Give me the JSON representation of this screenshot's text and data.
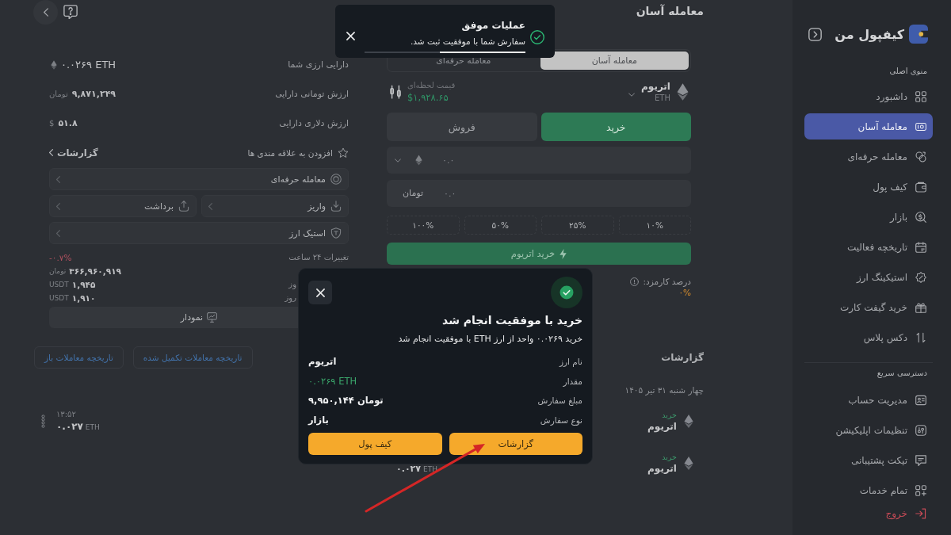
{
  "sidebar": {
    "logo": "کیفپول من",
    "sections": [
      {
        "title": "منوی اصلی",
        "items": [
          {
            "label": "داشبورد",
            "selected": false
          },
          {
            "label": "معامله آسان",
            "selected": true
          },
          {
            "label": "معامله حرفه‌ای",
            "selected": false
          },
          {
            "label": "کیف پول",
            "selected": false
          },
          {
            "label": "بازار",
            "selected": false
          },
          {
            "label": "تاریخچه فعالیت",
            "selected": false
          },
          {
            "label": "استیکینگ ارز",
            "selected": false
          },
          {
            "label": "خرید گیفت کارت",
            "selected": false
          },
          {
            "label": "دکس پلاس",
            "selected": false
          }
        ]
      },
      {
        "title": "دسترسی سریع",
        "items": [
          {
            "label": "مدیریت حساب",
            "selected": false
          },
          {
            "label": "تنظیمات اپلیکیشن",
            "selected": false
          },
          {
            "label": "تیکت پشتیبانی",
            "selected": false
          },
          {
            "label": "تمام خدمات",
            "selected": false
          }
        ]
      }
    ],
    "logout": {
      "label": "خروج"
    }
  },
  "trade": {
    "title": "معامله آسان",
    "tabs": [
      {
        "label": "معامله آسان",
        "selected": true
      },
      {
        "label": "معامله حرفه‌ای",
        "selected": false
      }
    ],
    "coin": {
      "name": "اتریوم",
      "symbol": "ETH"
    },
    "price": {
      "label": "قیمت لحظه‌ای",
      "value": "$۱,۹۲۸.۶۵"
    },
    "sides": [
      {
        "label": "خرید",
        "selected": true
      },
      {
        "label": "فروش",
        "selected": false
      }
    ],
    "amount_field": {
      "placeholder": "۰.۰"
    },
    "toman_field": {
      "placeholder": "۰.۰",
      "unit": "تومان"
    },
    "percent_buttons": [
      "۱۰%",
      "۲۵%",
      "۵۰%",
      "۱۰۰%"
    ],
    "submit_button": "خرید اتریوم",
    "fee": {
      "label": "درصد کارمزد:",
      "value": "۰%"
    },
    "reports": {
      "title": "گزارشات",
      "date": "چهار شنبه ۳۱ تیر ۱۴۰۵",
      "rows": [
        {
          "kind": "buy",
          "side": "خرید",
          "coin": "اتریوم"
        },
        {
          "kind": "buy",
          "side": "خرید",
          "coin": "اتریوم",
          "amount": "۰.۰۲۷",
          "unit": "ETH"
        }
      ]
    }
  },
  "assets": {
    "info": [
      {
        "kind": "coin",
        "label": "دارایی ارزی شما",
        "value": "۰.۰۲۶۹ ETH"
      },
      {
        "kind": "fiat",
        "label": "ارزش تومانی دارایی",
        "value": "۹,۸۷۱,۲۴۹",
        "unit": "تومان"
      },
      {
        "kind": "fiat",
        "label": "ارزش دلاری دارایی",
        "value": "۵۱.۸",
        "unit": "$"
      }
    ],
    "favorite": {
      "label": "افزودن به علاقه مندی ها",
      "on": false
    },
    "reports_link": "گزارشات",
    "action_rows": [
      {
        "items": [
          {
            "label": "معامله حرفه‌ای"
          }
        ]
      },
      {
        "items": [
          {
            "label": "واریز"
          },
          {
            "label": "برداشت"
          }
        ]
      },
      {
        "items": [
          {
            "label": "استیک ارز"
          }
        ]
      }
    ],
    "stats": [
      {
        "label": "تغییرات ۲۴ ساعت",
        "value": "-۰.۷%",
        "negative": true
      },
      {
        "value": "۳۶۶,۹۶۰,۹۱۹",
        "unit": "تومان",
        "negative": false
      },
      {
        "label": "وز",
        "value": "۱,۹۴۵",
        "unit": "USDT",
        "negative": false
      },
      {
        "label": "روز",
        "value": "۱,۹۱۰",
        "unit": "USDT",
        "negative": false
      }
    ],
    "chart_button": "نمودار",
    "history_buttons": [
      "تاریخچه معاملات تکمیل شده",
      "تاریخچه معاملات باز"
    ],
    "trades": [
      {
        "time": "۱۳:۵۲",
        "amount": "۰.۰۲۷",
        "unit": "ETH"
      }
    ]
  },
  "toast": {
    "title": "عملیات موفق",
    "message": "سفارش شما با موفقیت ثبت شد.",
    "level": 0.53
  },
  "modal": {
    "title": "خرید با موفقیت انجام شد",
    "message": "خرید ۰.۰۲۶۹ واحد از ارز ETH با موفقیت انجام شد",
    "details": [
      {
        "label": "نام ارز",
        "value": "اتریوم",
        "highlight": false
      },
      {
        "label": "مقدار",
        "value": "۰.۰۲۶۹ ETH",
        "highlight": true
      },
      {
        "label": "مبلغ سفارش",
        "value": "۹,۹۵۰,۱۴۴ تومان",
        "highlight": false
      },
      {
        "label": "نوع سفارش",
        "value": "بازار",
        "highlight": false
      }
    ],
    "buttons": [
      "گزارشات",
      "کیف پول"
    ]
  }
}
